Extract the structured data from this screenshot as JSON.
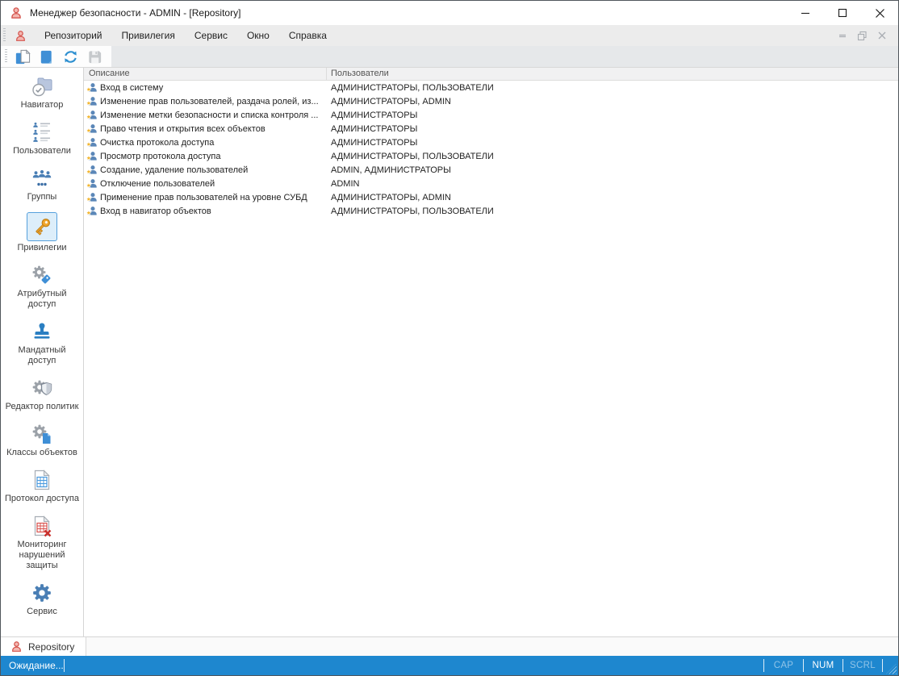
{
  "window": {
    "title": "Менеджер безопасности - ADMIN - [Repository]",
    "controls": [
      "minimize-icon",
      "maximize-icon",
      "close-icon"
    ],
    "mdi_controls": [
      "mdi-minimize-icon",
      "mdi-restore-icon",
      "mdi-close-icon"
    ]
  },
  "menu": {
    "items": [
      "Репозиторий",
      "Привилегия",
      "Сервис",
      "Окно",
      "Справка"
    ]
  },
  "toolbar": {
    "buttons": [
      {
        "icon": "copy-document-icon",
        "enabled": true
      },
      {
        "icon": "open-document-icon",
        "enabled": true
      },
      {
        "icon": "refresh-icon",
        "enabled": true
      },
      {
        "icon": "save-icon",
        "enabled": false
      }
    ]
  },
  "sidebar": {
    "items": [
      {
        "label": "Навигатор",
        "icon": "navigator-icon",
        "selected": false
      },
      {
        "label": "Пользователи",
        "icon": "users-icon",
        "selected": false
      },
      {
        "label": "Группы",
        "icon": "groups-icon",
        "selected": false
      },
      {
        "label": "Привилегии",
        "icon": "key-icon",
        "selected": true
      },
      {
        "label": "Атрибутный доступ",
        "icon": "attribute-access-icon",
        "selected": false
      },
      {
        "label": "Мандатный доступ",
        "icon": "mandatory-access-icon",
        "selected": false
      },
      {
        "label": "Редактор политик",
        "icon": "policy-editor-icon",
        "selected": false
      },
      {
        "label": "Классы объектов",
        "icon": "object-classes-icon",
        "selected": false
      },
      {
        "label": "Протокол доступа",
        "icon": "access-log-icon",
        "selected": false
      },
      {
        "label": "Мониторинг нарушений защиты",
        "icon": "violation-monitoring-icon",
        "selected": false
      },
      {
        "label": "Сервис",
        "icon": "service-icon",
        "selected": false
      }
    ]
  },
  "table": {
    "columns": [
      "Описание",
      "Пользователи"
    ],
    "row_icon": "privilege-user-star-icon",
    "rows": [
      {
        "description": "Вход в систему",
        "users": "АДМИНИСТРАТОРЫ, ПОЛЬЗОВАТЕЛИ"
      },
      {
        "description": "Изменение прав пользователей, раздача ролей, из...",
        "users": "АДМИНИСТРАТОРЫ, ADMIN"
      },
      {
        "description": "Изменение метки безопасности и списка контроля ...",
        "users": "АДМИНИСТРАТОРЫ"
      },
      {
        "description": "Право чтения и открытия всех объектов",
        "users": "АДМИНИСТРАТОРЫ"
      },
      {
        "description": "Очистка протокола доступа",
        "users": "АДМИНИСТРАТОРЫ"
      },
      {
        "description": "Просмотр протокола доступа",
        "users": "АДМИНИСТРАТОРЫ, ПОЛЬЗОВАТЕЛИ"
      },
      {
        "description": "Создание, удаление пользователей",
        "users": "ADMIN, АДМИНИСТРАТОРЫ"
      },
      {
        "description": "Отключение пользователей",
        "users": "ADMIN"
      },
      {
        "description": "Применение прав пользователей на уровне СУБД",
        "users": "АДМИНИСТРАТОРЫ, ADMIN"
      },
      {
        "description": "Вход в навигатор объектов",
        "users": "АДМИНИСТРАТОРЫ, ПОЛЬЗОВАТЕЛИ"
      }
    ]
  },
  "tabs": [
    {
      "label": "Repository",
      "icon": "repository-icon",
      "active": true
    }
  ],
  "statusbar": {
    "status": "Ожидание...",
    "indicators": [
      {
        "label": "CAP",
        "active": false
      },
      {
        "label": "NUM",
        "active": true
      },
      {
        "label": "SCRL",
        "active": false
      }
    ]
  },
  "colors": {
    "accent_blue": "#1e87cf",
    "selection_bg": "#ddeefa",
    "selection_border": "#56a0dc",
    "key_orange": "#f0a62c",
    "person_blue": "#5b87b8",
    "star_gold": "#f2b632",
    "alert_red": "#d9534f",
    "app_icon_red": "#d5544d"
  }
}
